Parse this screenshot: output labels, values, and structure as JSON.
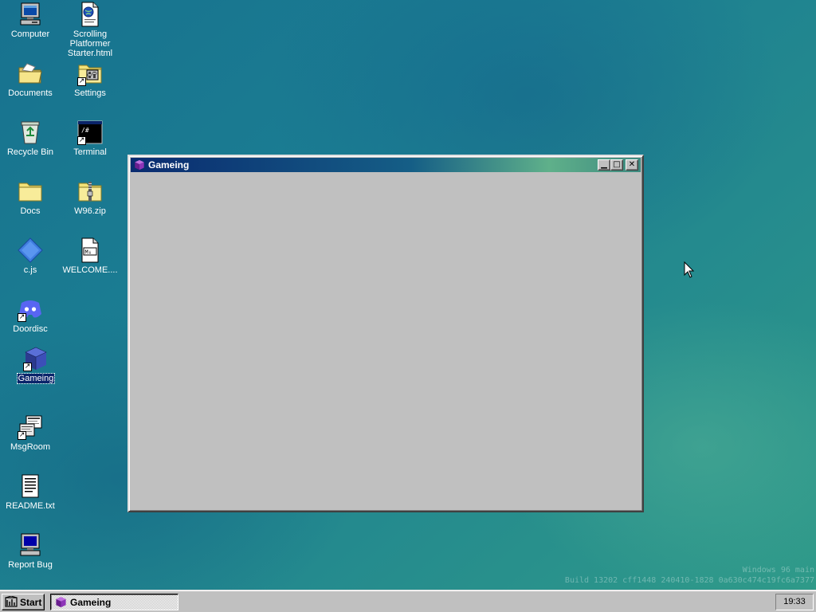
{
  "desktop": {
    "icons": [
      {
        "label": "Computer",
        "icon": "computer-icon"
      },
      {
        "label": "Scrolling Platformer Starter.html",
        "icon": "html-document-icon"
      },
      {
        "label": "Documents",
        "icon": "open-folder-icon"
      },
      {
        "label": "Settings",
        "icon": "settings-folder-icon"
      },
      {
        "label": "Recycle Bin",
        "icon": "recycle-bin-icon"
      },
      {
        "label": "Terminal",
        "icon": "terminal-icon"
      },
      {
        "label": "Docs",
        "icon": "folder-icon"
      },
      {
        "label": "W96.zip",
        "icon": "zip-folder-icon"
      },
      {
        "label": "c.js",
        "icon": "script-diamond-icon"
      },
      {
        "label": "WELCOME....",
        "icon": "markdown-file-icon"
      },
      {
        "label": "Doordisc",
        "icon": "discord-icon"
      },
      {
        "label": "Gameing",
        "icon": "game-cube-icon",
        "selected": true
      },
      {
        "label": "MsgRoom",
        "icon": "msgroom-icon"
      },
      {
        "label": "README.txt",
        "icon": "text-file-icon"
      },
      {
        "label": "Report Bug",
        "icon": "report-bug-computer-icon"
      }
    ]
  },
  "window": {
    "title": "Gameing",
    "icon": "game-cube-icon",
    "buttons": {
      "minimize": "minimize-icon",
      "maximize": "maximize-icon",
      "close": "close-icon"
    }
  },
  "watermark": {
    "line1": "Windows 96 main",
    "line2": "Build 13202 cff1448 240410-1828 0a630c474c19fc6a7377"
  },
  "taskbar": {
    "start_label": "Start",
    "tasks": [
      {
        "label": "Gameing",
        "icon": "game-cube-icon",
        "active": true
      }
    ],
    "clock": "19:33"
  },
  "colors": {
    "desktop": "#1b7d92",
    "titlebar_start": "#0a2b70",
    "titlebar_end": "#5fb08a",
    "selection": "#0a246a",
    "chrome": "#c0c0c0"
  }
}
